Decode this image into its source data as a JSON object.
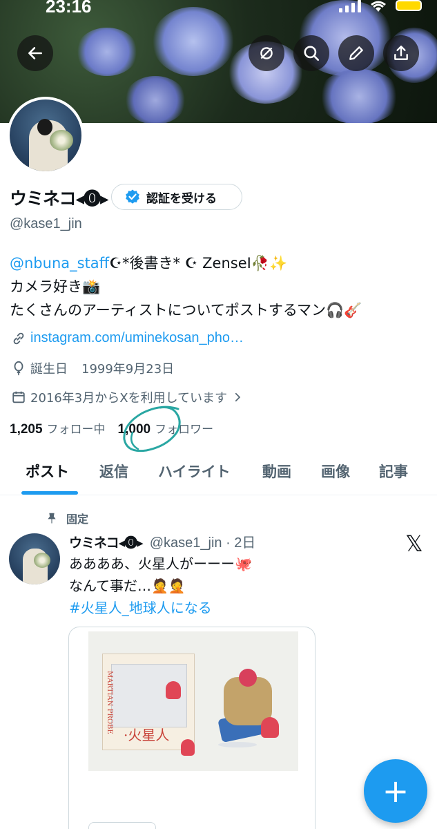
{
  "status_bar": {
    "time": "23:16"
  },
  "profile": {
    "display_name": "ウミネコ◂⓿▸",
    "verify_label": "認証を受ける",
    "handle": "@kase1_jin",
    "bio_mention": "@nbuna_staff",
    "bio_line1_rest": "☪*後書き* ☪ ZenseⅠ🥀✨",
    "bio_line2": "カメラ好き📸",
    "bio_line3": "たくさんのアーティストについてポストするマン🎧🎸",
    "link": "instagram.com/uminekosan_pho…",
    "birthday_label": "誕生日",
    "birthday_value": "1999年9月23日",
    "joined": "2016年3月からXを利用しています",
    "following_count": "1,205",
    "following_label": "フォロー中",
    "followers_count": "1,000",
    "followers_label": "フォロワー"
  },
  "tabs": [
    "ポスト",
    "返信",
    "ハイライト",
    "動画",
    "画像",
    "記事"
  ],
  "post": {
    "pinned_label": "固定",
    "author_name": "ウミネコ◂⓿▸",
    "author_handle_time": "@kase1_jin · 2日",
    "line1": "ああああ、火星人がーーー🐙",
    "line2": "なんて事だ…🤦🤦",
    "hashtag": "#火星人_地球人になる",
    "x_logo": "𝕏",
    "box_label": "·火星人",
    "box_side_text": "MARTIAN PROBE"
  },
  "fab": {
    "label": "+"
  },
  "colors": {
    "accent": "#1d9bf0",
    "text": "#0f1419",
    "muted": "#536471",
    "scribble": "#2aa7a3"
  },
  "icons": [
    "back-arrow-icon",
    "no-sync-icon",
    "search-icon",
    "pencil-icon",
    "share-icon",
    "verified-badge-icon",
    "link-icon",
    "balloon-icon",
    "calendar-icon",
    "pin-icon",
    "x-logo-icon",
    "plus-icon"
  ]
}
